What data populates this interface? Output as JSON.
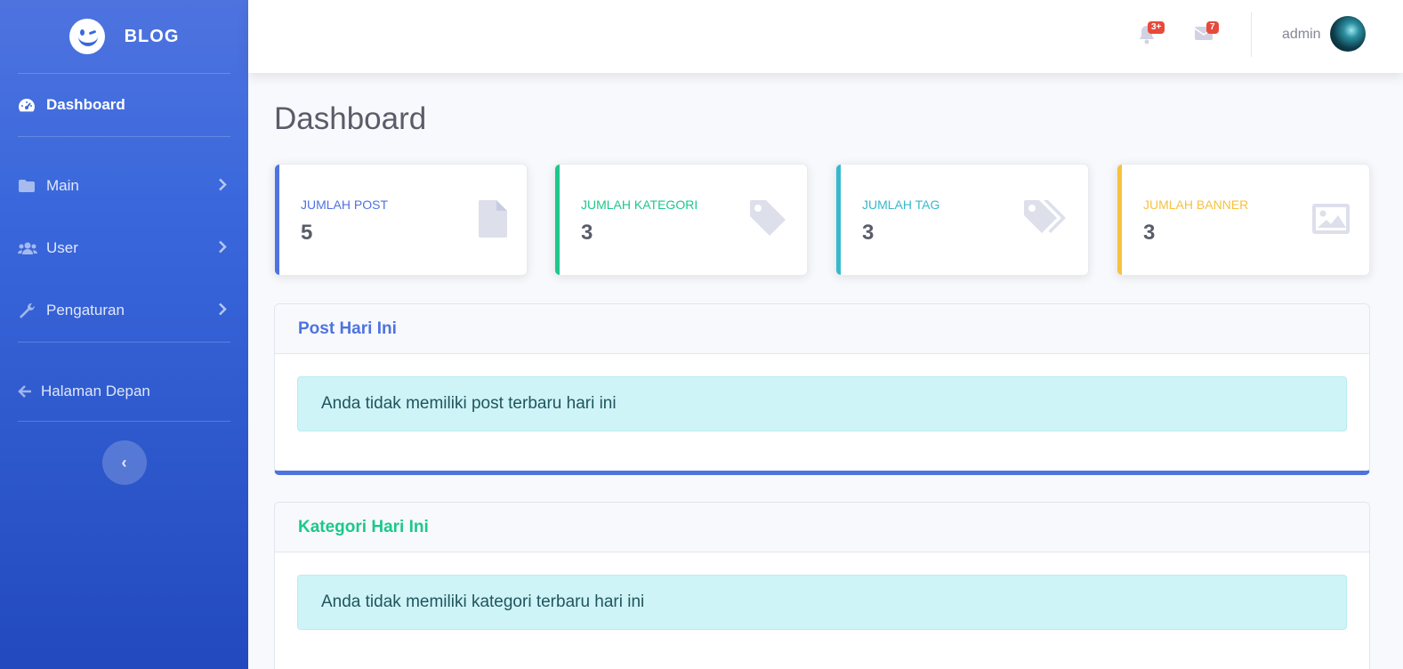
{
  "brand": {
    "name": "BLOG"
  },
  "sidebar": {
    "items": [
      {
        "label": "Dashboard",
        "icon": "tachometer-icon",
        "active": true
      },
      {
        "label": "Main",
        "icon": "folder-icon"
      },
      {
        "label": "User",
        "icon": "users-icon"
      },
      {
        "label": "Pengaturan",
        "icon": "wrench-icon"
      },
      {
        "label": "Halaman Depan",
        "icon": "arrow-left-icon"
      }
    ],
    "toggle_glyph": "‹"
  },
  "topbar": {
    "alerts_badge": "3+",
    "messages_badge": "7",
    "user_name": "admin"
  },
  "page": {
    "title": "Dashboard"
  },
  "cards": [
    {
      "label": "JUMLAH POST",
      "value": "5",
      "color": "#4e73df",
      "icon": "file-icon"
    },
    {
      "label": "JUMLAH KATEGORI",
      "value": "3",
      "color": "#1cc88a",
      "icon": "tag-icon"
    },
    {
      "label": "JUMLAH TAG",
      "value": "3",
      "color": "#36b9cc",
      "icon": "tags-icon"
    },
    {
      "label": "JUMLAH BANNER",
      "value": "3",
      "color": "#f6c23e",
      "icon": "image-icon"
    }
  ],
  "panels": [
    {
      "title": "Post Hari Ini",
      "message": "Anda tidak memiliki post terbaru hari ini",
      "color": "#4e73df"
    },
    {
      "title": "Kategori Hari Ini",
      "message": "Anda tidak memiliki kategori terbaru hari ini",
      "color": "#1cc88a"
    }
  ]
}
